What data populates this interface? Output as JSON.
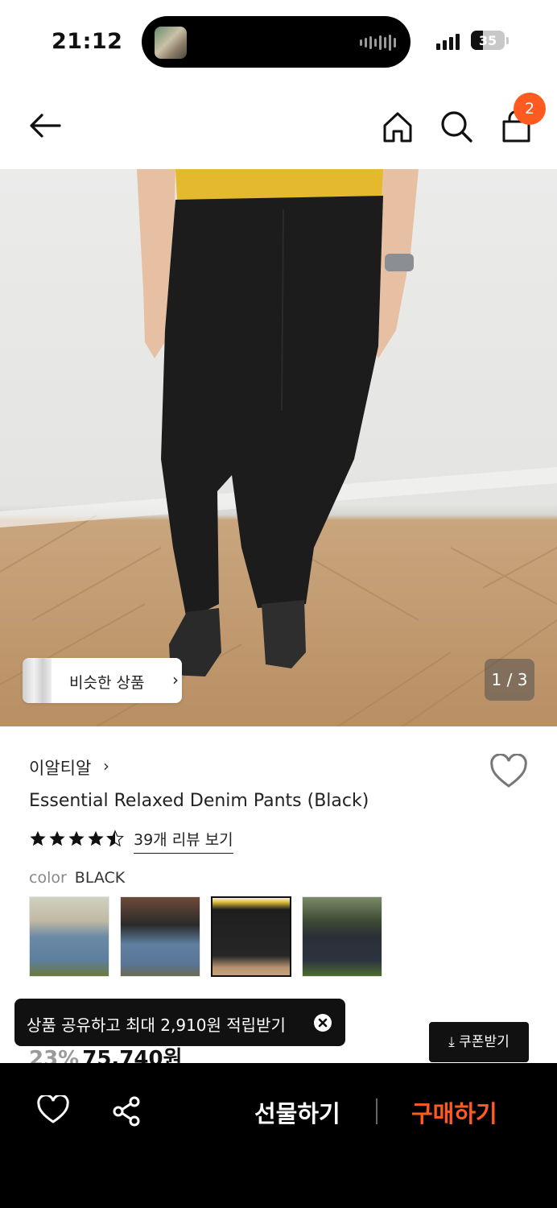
{
  "status_bar": {
    "time": "21:12",
    "battery": "35"
  },
  "nav": {
    "cart_count": "2"
  },
  "hero": {
    "similar_label": "비슷한 상품",
    "pager": "1 / 3"
  },
  "product": {
    "brand": "이알티알",
    "title": "Essential Relaxed Denim Pants (Black)",
    "rating": 4.5,
    "reviews_label": "39개 리뷰 보기",
    "color_label": "color",
    "color_value": "BLACK",
    "swatch_count_selected": 3
  },
  "price": {
    "discount": "23%",
    "amount": "75,740원"
  },
  "toast": {
    "text": "상품 공유하고 최대 2,910원 적립받기"
  },
  "coupon": {
    "label": "⤓ 쿠폰받기"
  },
  "bottom_bar": {
    "gift_label": "선물하기",
    "buy_label": "구매하기"
  },
  "colors": {
    "accent": "#ff5a1f",
    "dark": "#111111"
  }
}
